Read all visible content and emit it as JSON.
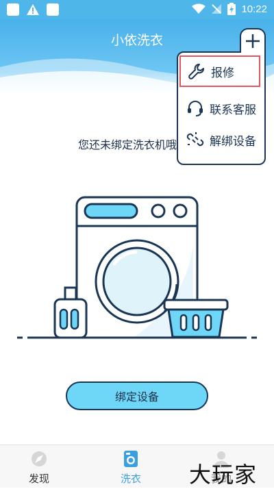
{
  "status_bar": {
    "time": "10:22"
  },
  "header": {
    "title": "小依洗衣"
  },
  "menu": {
    "items": [
      {
        "label": "报修",
        "icon": "wrench-icon",
        "selected": true
      },
      {
        "label": "联系客服",
        "icon": "headset-icon",
        "selected": false
      },
      {
        "label": "解绑设备",
        "icon": "unlink-icon",
        "selected": false
      }
    ]
  },
  "main": {
    "message": "您还未绑定洗衣机哦",
    "bind_button": "绑定设备"
  },
  "bottom_nav": {
    "items": [
      {
        "label": "发现",
        "icon": "discover-icon",
        "active": false
      },
      {
        "label": "洗衣",
        "icon": "washer-icon",
        "active": true
      },
      {
        "label": "我的",
        "icon": "profile-icon",
        "active": false
      }
    ]
  },
  "watermark": "大玩家",
  "colors": {
    "primary": "#4fb6ea",
    "accent": "#6ed6f6",
    "outline": "#1a3553",
    "highlight": "#e25560"
  }
}
